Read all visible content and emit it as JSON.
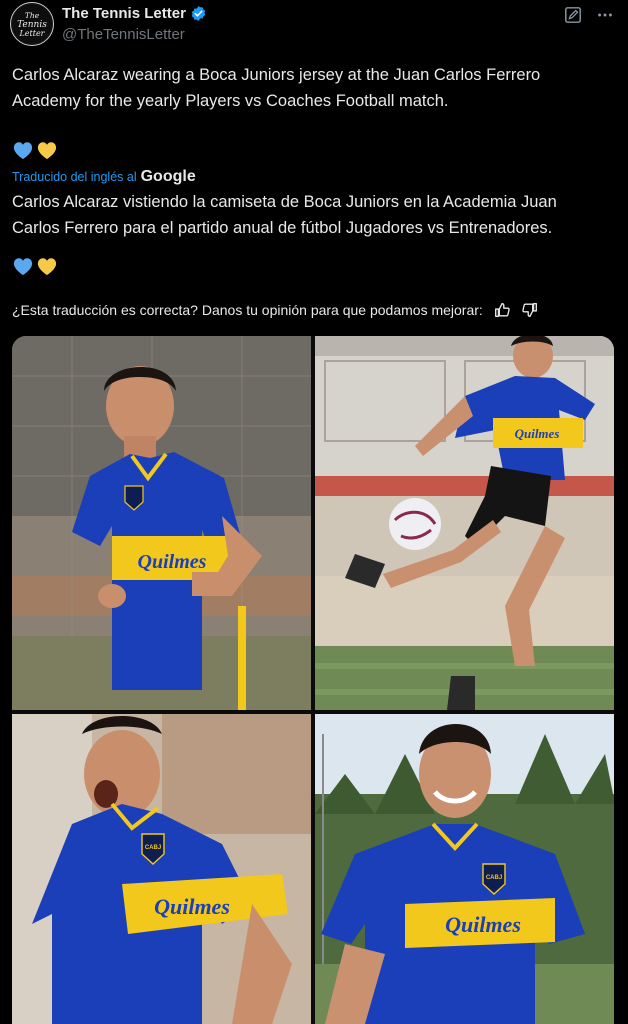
{
  "account": {
    "name": "The Tennis Letter",
    "handle": "@TheTennisLetter",
    "avatar_text": [
      "The",
      "Tennis",
      "Letter"
    ]
  },
  "tweet": {
    "text": "Carlos Alcaraz wearing a Boca Juniors jersey at the Juan Carlos Ferrero Academy for the yearly Players vs Coaches Football match.",
    "emoji_hearts": [
      "blue-heart",
      "yellow-heart"
    ]
  },
  "translation": {
    "label": "Traducido del inglés al",
    "provider": "Google",
    "text": "Carlos Alcaraz vistiendo la camiseta de Boca Juniors en la Academia Juan Carlos Ferrero para el partido anual de fútbol Jugadores vs Entrenadores.",
    "feedback_prompt": "¿Esta traducción es correcta? Danos tu opinión para que podamos mejorar:"
  },
  "colors": {
    "background": "#000000",
    "link_blue": "#1d9bf0",
    "jersey_blue": "#1a3fb8",
    "jersey_yellow": "#f2c81c"
  },
  "media": {
    "jersey_sponsor": "Quilmes",
    "crest_text": "CABJ"
  },
  "icons": [
    "verified-badge-icon",
    "edit-icon",
    "more-icon",
    "thumbs-up-icon",
    "thumbs-down-icon"
  ]
}
